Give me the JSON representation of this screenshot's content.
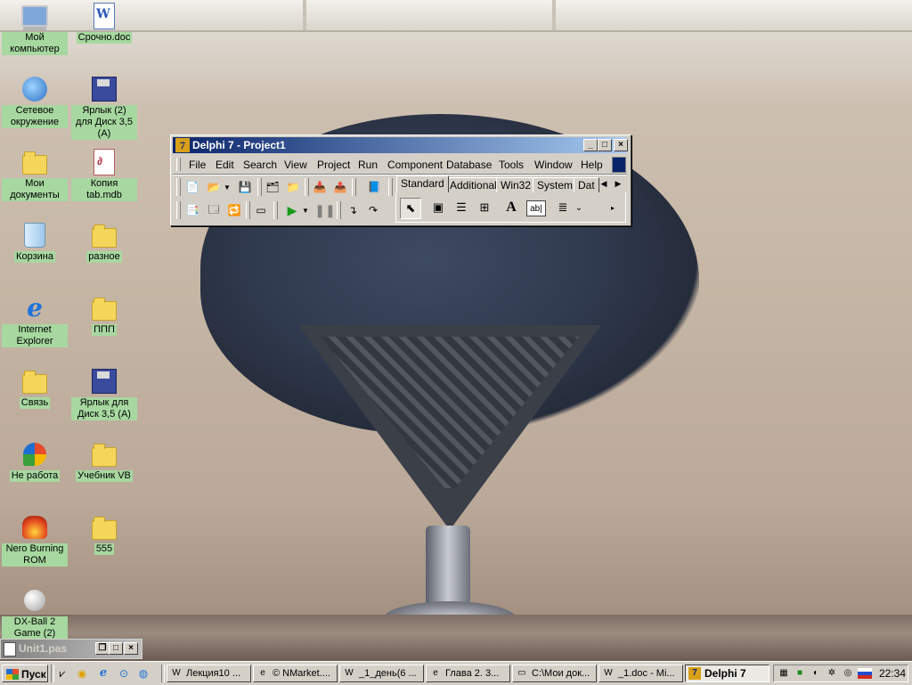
{
  "desktop": {
    "icons": [
      {
        "label": "Мой компьютер",
        "icon": "my-computer-icon"
      },
      {
        "label": "Срочно.doc",
        "icon": "word-document-icon"
      },
      {
        "label": "Сетевое окружение",
        "icon": "network-places-icon"
      },
      {
        "label": "Ярлык (2) для Диск 3,5 (A)",
        "icon": "floppy-shortcut-icon"
      },
      {
        "label": "Мои документы",
        "icon": "my-documents-icon"
      },
      {
        "label": "Копия tab.mdb",
        "icon": "access-database-icon"
      },
      {
        "label": "Корзина",
        "icon": "recycle-bin-icon"
      },
      {
        "label": "разное",
        "icon": "folder-icon"
      },
      {
        "label": "Internet Explorer",
        "icon": "internet-explorer-icon"
      },
      {
        "label": "ППП",
        "icon": "folder-icon"
      },
      {
        "label": "Связь",
        "icon": "folder-icon"
      },
      {
        "label": "Ярлык для Диск 3,5 (A)",
        "icon": "floppy-shortcut-icon"
      },
      {
        "label": "Не работа",
        "icon": "msn-icon"
      },
      {
        "label": "Учебник VB",
        "icon": "folder-icon"
      },
      {
        "label": "Nero Burning ROM",
        "icon": "nero-icon"
      },
      {
        "label": "555",
        "icon": "folder-icon"
      },
      {
        "label": "DX-Ball 2 Game (2)",
        "icon": "dx-ball-icon"
      }
    ]
  },
  "delphi": {
    "title": "Delphi 7 - Project1",
    "menu": [
      "File",
      "Edit",
      "Search",
      "View",
      "Project",
      "Run",
      "Component",
      "Database",
      "Tools",
      "Window",
      "Help"
    ],
    "palette_tabs": [
      "Standard",
      "Additional",
      "Win32",
      "System",
      "Dat"
    ],
    "active_tab": "Standard",
    "palette_text_icon": "A"
  },
  "minimized_window": {
    "title": "Unit1.pas"
  },
  "taskbar": {
    "start_label": "Пуск",
    "tasks": [
      {
        "label": "Лекция10 ...",
        "icon": "word-icon"
      },
      {
        "label": "© NMarket....",
        "icon": "ie-icon"
      },
      {
        "label": "_1_день(6 ...",
        "icon": "word-icon"
      },
      {
        "label": "Глава 2. 3...",
        "icon": "ie-icon"
      },
      {
        "label": "C:\\Мои док...",
        "icon": "folder-icon"
      },
      {
        "label": "_1.doc - Mi...",
        "icon": "word-icon"
      },
      {
        "label": "Delphi 7",
        "icon": "delphi-icon",
        "active": true
      }
    ],
    "clock": "22:34"
  },
  "colors": {
    "title_active_start": "#0a246a",
    "title_active_end": "#a6caf0",
    "desktop_label_bg": "#a7d8a0",
    "face": "#d4d0c8"
  }
}
